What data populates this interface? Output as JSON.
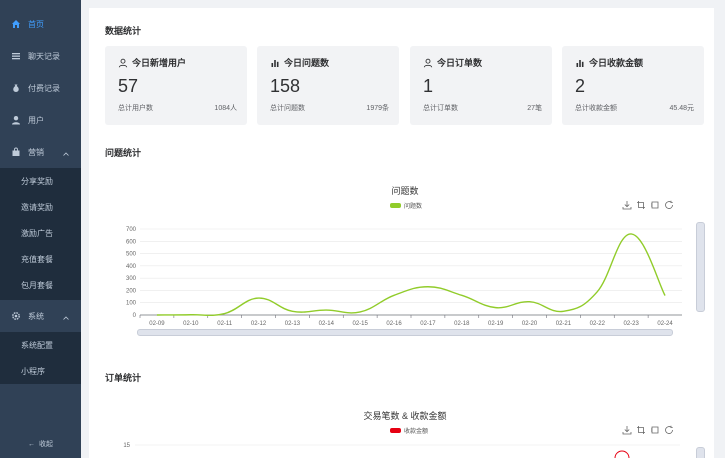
{
  "sidebar": {
    "items": [
      {
        "label": "首页",
        "icon": "home-icon"
      },
      {
        "label": "聊天记录",
        "icon": "list-icon"
      },
      {
        "label": "付费记录",
        "icon": "money-bag-icon"
      },
      {
        "label": "用户",
        "icon": "user-icon"
      },
      {
        "label": "营销",
        "icon": "shopping-bag-icon"
      },
      {
        "label": "系统",
        "icon": "gear-icon"
      }
    ],
    "marketing_sub": [
      "分享奖励",
      "邀请奖励",
      "激励广告",
      "充值套餐",
      "包月套餐"
    ],
    "system_sub": [
      "系统配置",
      "小程序"
    ],
    "collapse_label": "收起"
  },
  "stats": {
    "title": "数据统计",
    "cards": [
      {
        "title": "今日新增用户",
        "icon": "user-icon",
        "value": "57",
        "foot_label": "总计用户数",
        "foot_value": "1084人"
      },
      {
        "title": "今日问题数",
        "icon": "bar-chart-icon",
        "value": "158",
        "foot_label": "总计问题数",
        "foot_value": "1979条"
      },
      {
        "title": "今日订单数",
        "icon": "user-icon",
        "value": "1",
        "foot_label": "总计订单数",
        "foot_value": "27笔"
      },
      {
        "title": "今日收款金额",
        "icon": "bar-chart-icon",
        "value": "2",
        "foot_label": "总计收款金额",
        "foot_value": "45.48元"
      }
    ]
  },
  "questions": {
    "section_title": "问题统计"
  },
  "orders": {
    "section_title": "订单统计"
  },
  "colors": {
    "sidebar_bg": "#304156",
    "submenu_bg": "#1f2d3d",
    "active": "#409eff",
    "question_line": "#91cc2a",
    "order_legend": "#e60012"
  },
  "chart_data": [
    {
      "type": "line",
      "title": "问题数",
      "categories": [
        "02-09",
        "02-10",
        "02-11",
        "02-12",
        "02-13",
        "02-14",
        "02-15",
        "02-16",
        "02-17",
        "02-18",
        "02-19",
        "02-20",
        "02-21",
        "02-22",
        "02-23",
        "02-24"
      ],
      "series": [
        {
          "name": "问题数",
          "values": [
            0,
            2,
            12,
            138,
            30,
            40,
            25,
            160,
            230,
            160,
            60,
            108,
            30,
            190,
            660,
            158
          ]
        }
      ],
      "ylim": [
        0,
        700
      ],
      "yticks": [
        "0",
        "100",
        "200",
        "300",
        "400",
        "500",
        "600",
        "700"
      ],
      "smooth": true,
      "legend": "top-center",
      "toolbox": [
        "download-icon",
        "zoom-icon",
        "zoom-reset-icon",
        "restore-icon"
      ]
    },
    {
      "type": "line",
      "title": "交易笔数 & 收款金额",
      "series": [
        {
          "name": "收款金额",
          "values": []
        }
      ],
      "yticks": [
        "15"
      ],
      "legend": "top-center",
      "toolbox": [
        "download-icon",
        "zoom-icon",
        "zoom-reset-icon",
        "restore-icon"
      ]
    }
  ]
}
